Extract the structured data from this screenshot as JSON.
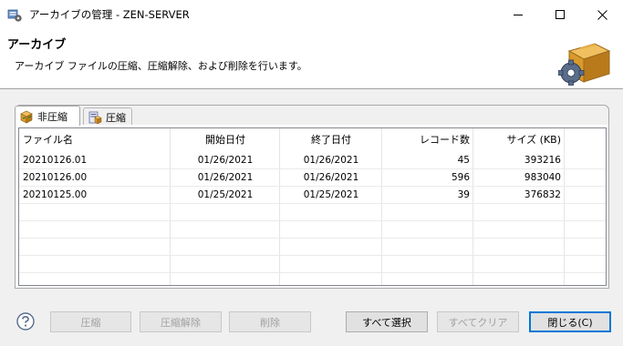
{
  "window": {
    "title": "アーカイブの管理 - ZEN-SERVER"
  },
  "header": {
    "title": "アーカイブ",
    "description": "アーカイブ ファイルの圧縮、圧縮解除、および削除を行います。"
  },
  "tabs": [
    {
      "label": "非圧縮",
      "icon": "uncompressed-box-icon",
      "active": true
    },
    {
      "label": "圧縮",
      "icon": "compressed-archive-icon",
      "active": false
    }
  ],
  "table": {
    "columns": [
      "ファイル名",
      "開始日付",
      "終了日付",
      "レコード数",
      "サイズ (KB)"
    ],
    "rows": [
      {
        "file": "20210126.01",
        "start": "01/26/2021",
        "end": "01/26/2021",
        "records": "45",
        "size": "393216"
      },
      {
        "file": "20210126.00",
        "start": "01/26/2021",
        "end": "01/26/2021",
        "records": "596",
        "size": "983040"
      },
      {
        "file": "20210125.00",
        "start": "01/25/2021",
        "end": "01/25/2021",
        "records": "39",
        "size": "376832"
      }
    ]
  },
  "buttons": {
    "compress": "圧縮",
    "decompress": "圧縮解除",
    "delete": "削除",
    "select_all": "すべて選択",
    "clear_all": "すべてクリア",
    "close": "閉じる(C)"
  },
  "colors": {
    "accent": "#0078d7",
    "box": "#d99a2b"
  }
}
